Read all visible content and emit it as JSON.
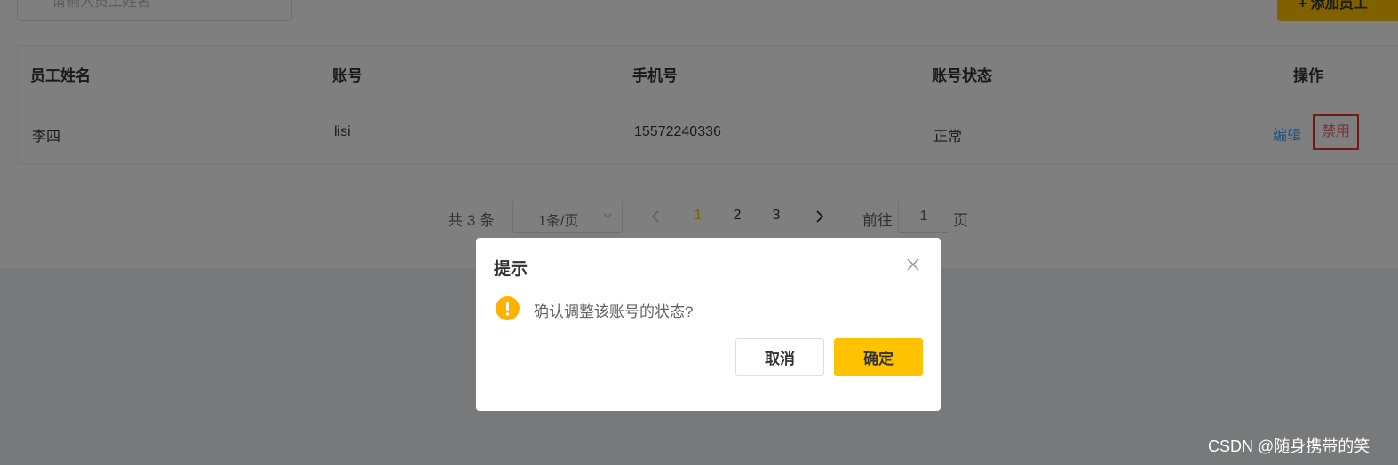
{
  "search": {
    "placeholder": "请输入员工姓名"
  },
  "toolbar": {
    "add_label": "+ 添加员工"
  },
  "table": {
    "headers": [
      "员工姓名",
      "账号",
      "手机号",
      "账号状态",
      "操作"
    ],
    "rows": [
      {
        "name": "李四",
        "account": "lisi",
        "phone": "15572240336",
        "status": "正常",
        "actions": [
          "编辑",
          "禁用"
        ]
      }
    ]
  },
  "pagination": {
    "total_text": "共 3 条",
    "page_size": "1条/页",
    "pages": [
      "1",
      "2",
      "3"
    ],
    "current_page": "1",
    "goto_label": "前往",
    "goto_value": "1",
    "goto_suffix": "页"
  },
  "dialog": {
    "title": "提示",
    "message": "确认调整该账号的状态?",
    "cancel_label": "取消",
    "confirm_label": "确定"
  },
  "watermark": "CSDN @随身携带的笑",
  "colors": {
    "primary": "#ffc200",
    "link": "#419eff",
    "danger": "#f56c6c",
    "highlight_border": "#e8322f",
    "warning": "#ffb100"
  },
  "icons": {
    "search": "search-icon",
    "chevron_down": "chevron-down-icon",
    "prev": "chevron-left-icon",
    "next": "chevron-right-icon",
    "close": "close-icon",
    "warning": "warning-icon"
  }
}
